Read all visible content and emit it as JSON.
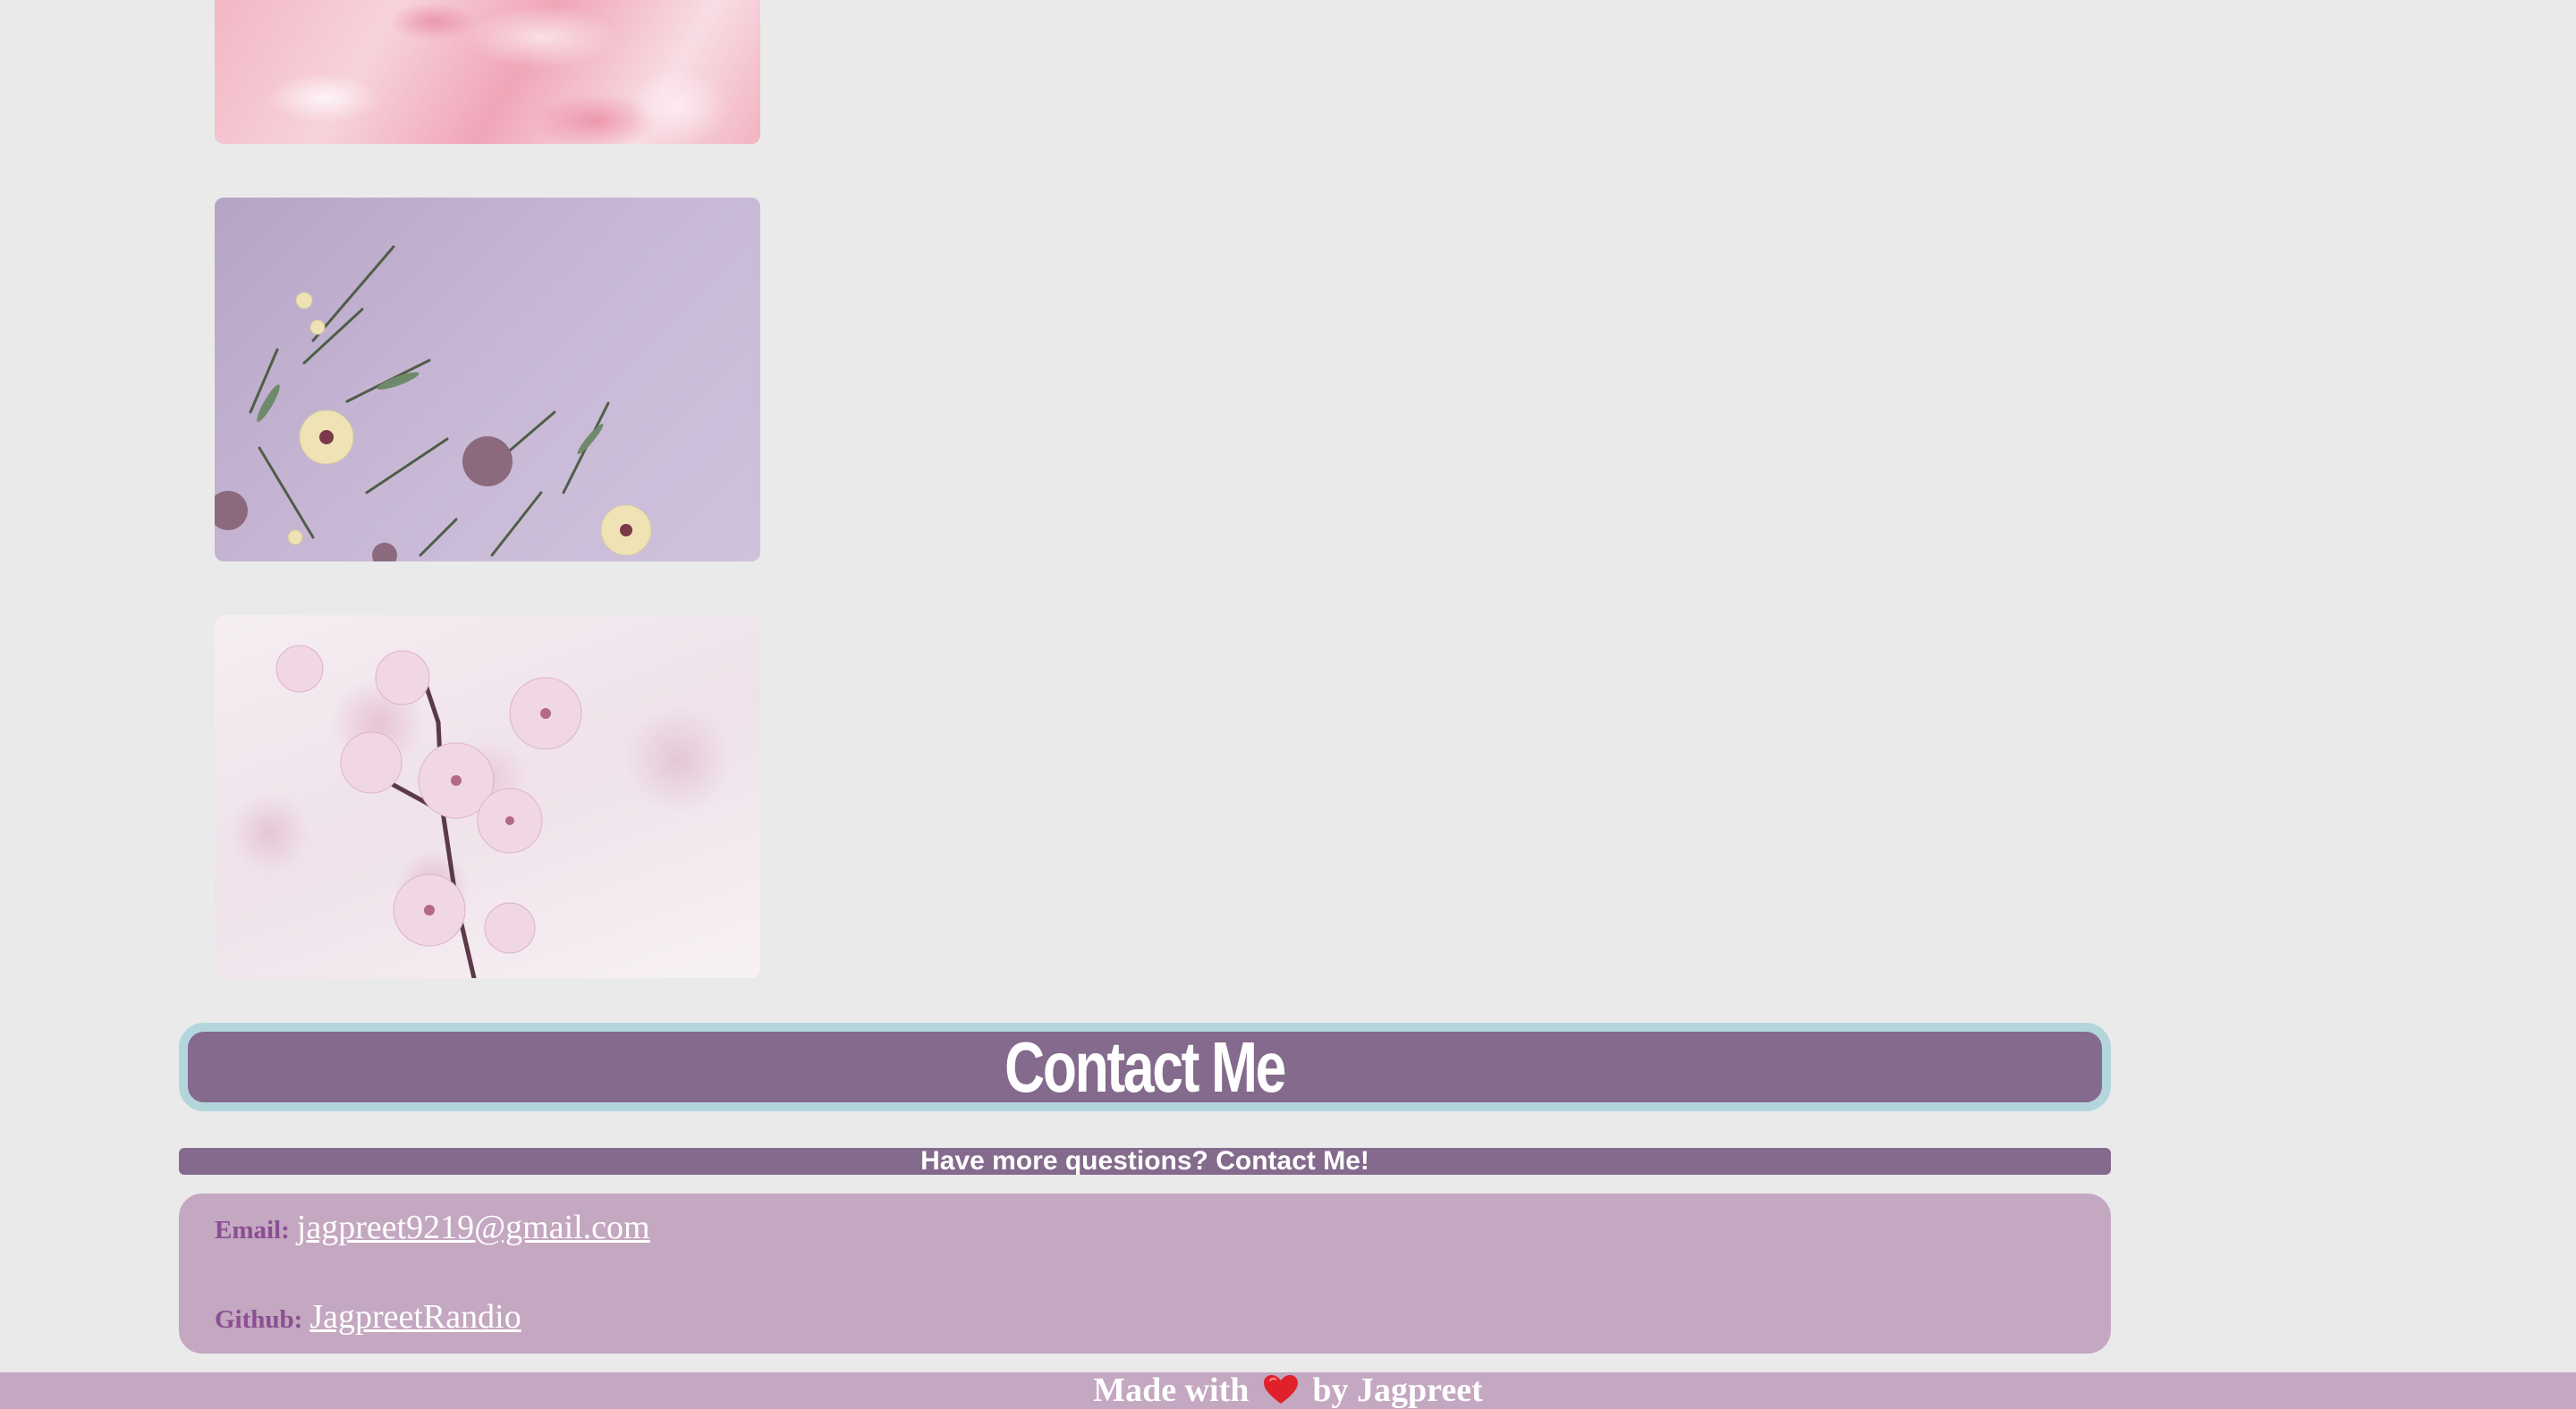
{
  "gallery": {
    "images": [
      {
        "name": "pink-marble-image",
        "depicts": "pink marble texture"
      },
      {
        "name": "lavender-flowers-image",
        "depicts": "dried flowers on lavender background"
      },
      {
        "name": "cherry-blossom-image",
        "depicts": "pink cherry blossoms"
      }
    ]
  },
  "contact": {
    "heading": "Contact Me",
    "subtitle": "Have more questions? Contact Me!",
    "email_label": "Email:",
    "email_value": "jagpreet9219@gmail.com",
    "github_label": "Github:",
    "github_value": "JagpreetRandio"
  },
  "footer": {
    "prefix": "Made with",
    "icon": "heart-icon",
    "suffix": "by Jagpreet"
  },
  "colors": {
    "page_bg": "#eaeaea",
    "accent_purple": "#846a8c",
    "card_mauve": "#c4a7c0",
    "heading_border": "#b3d6dd",
    "label_purple": "#8a4f93",
    "heart_red": "#e0202a"
  }
}
